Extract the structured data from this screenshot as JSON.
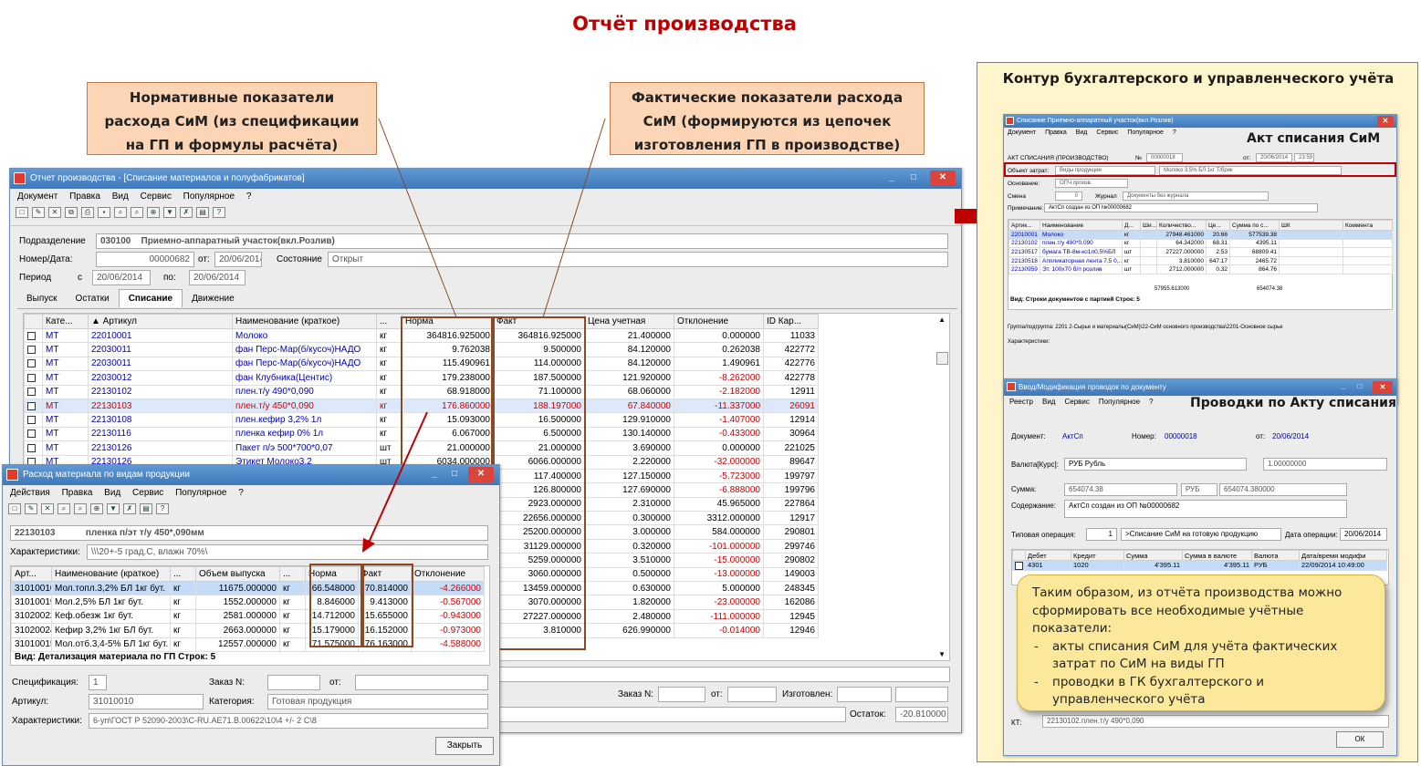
{
  "slide_title": "Отчёт производства",
  "callout_left": [
    "Нормативные показатели",
    "расхода СиМ (из спецификации",
    "на ГП и формулы расчёта)"
  ],
  "callout_right": [
    "Фактические показатели расхода",
    "СиМ (формируются из цепочек",
    "изготовления ГП в производстве)"
  ],
  "main_win": {
    "title": "Отчет производства - [Списание материалов и полуфабрикатов]",
    "menu": [
      "Документ",
      "Правка",
      "Вид",
      "Сервис",
      "Популярное",
      "?"
    ],
    "dept_label": "Подразделение",
    "dept_code": "030100",
    "dept_name": "Приемно-аппаратный участок(вкл.Розлив)",
    "num_label": "Номер/Дата:",
    "num_value": "00000682",
    "from_label": "от:",
    "date": "20/06/2014",
    "state_label": "Состояние",
    "state": "Открыт",
    "period_label": "Период",
    "period_from_label": "с",
    "period_from": "20/06/2014",
    "period_to_label": "по:",
    "period_to": "20/06/2014",
    "tabs": [
      "Выпуск",
      "Остатки",
      "Списание",
      "Движение"
    ],
    "columns": [
      "Кате...",
      "▲ Артикул",
      "Наименование (краткое)",
      "...",
      "Норма",
      "Факт",
      "Цена учетная",
      "Отклонение",
      "ID Кар..."
    ],
    "rows": [
      [
        "МТ",
        "22010001",
        "Молоко",
        "кг",
        "364816.925000",
        "364816.925000",
        "21.400000",
        "0.000000",
        "11033"
      ],
      [
        "МТ",
        "22030011",
        "фан Перс-Мар(б/кусоч)НАДО",
        "кг",
        "9.762038",
        "9.500000",
        "84.120000",
        "0.262038",
        "422772"
      ],
      [
        "МТ",
        "22030011",
        "фан Перс-Мар(б/кусоч)НАДО",
        "кг",
        "115.490961",
        "114.000000",
        "84.120000",
        "1.490961",
        "422776"
      ],
      [
        "МТ",
        "22030012",
        "фан Клубника(Центис)",
        "кг",
        "179.238000",
        "187.500000",
        "121.920000",
        "-8.262000",
        "422778"
      ],
      [
        "МТ",
        "22130102",
        "плен.т/у 490*0,090",
        "кг",
        "68.918000",
        "71.100000",
        "68.060000",
        "-2.182000",
        "12911"
      ],
      [
        "МТ",
        "22130103",
        "плен.т/у 450*0,090",
        "кг",
        "176.860000",
        "188.197000",
        "67.840000",
        "-11.337000",
        "26091"
      ],
      [
        "МТ",
        "22130108",
        "плен.кефир 3,2% 1л",
        "кг",
        "15.093000",
        "16.500000",
        "129.910000",
        "-1.407000",
        "12914"
      ],
      [
        "МТ",
        "22130116",
        "пленка кефир 0% 1л",
        "кг",
        "6.067000",
        "6.500000",
        "130.140000",
        "-0.433000",
        "30964"
      ],
      [
        "МТ",
        "22130126",
        "Пакет п/э 500*700*0,07",
        "шт",
        "21.000000",
        "21.000000",
        "3.690000",
        "0.000000",
        "221025"
      ],
      [
        "МТ",
        "22130126",
        "Этикет Молоко3,2",
        "шт",
        "6034.000000",
        "6066.000000",
        "2.220000",
        "-32.000000",
        "89647"
      ],
      [
        "",
        "",
        "",
        "",
        "",
        "117.400000",
        "127.150000",
        "-5.723000",
        "199797"
      ],
      [
        "",
        "",
        "",
        "",
        "",
        "126.800000",
        "127.690000",
        "-6.888000",
        "199796"
      ],
      [
        "",
        "",
        "",
        "",
        "",
        "2923.000000",
        "2.310000",
        "45.965000",
        "227864"
      ],
      [
        "",
        "",
        "",
        "",
        "",
        "22656.000000",
        "0.300000",
        "3312.000000",
        "12917"
      ],
      [
        "",
        "",
        "",
        "",
        "",
        "25200.000000",
        "3.000000",
        "584.000000",
        "290801"
      ],
      [
        "",
        "",
        "",
        "",
        "",
        "31129.000000",
        "0.320000",
        "-101.000000",
        "299746"
      ],
      [
        "",
        "",
        "",
        "",
        "",
        "5259.000000",
        "3.510000",
        "-15.000000",
        "290802"
      ],
      [
        "",
        "",
        "",
        "",
        "",
        "3060.000000",
        "0.500000",
        "-13.000000",
        "149003"
      ],
      [
        "",
        "",
        "",
        "",
        "",
        "13459.000000",
        "0.630000",
        "5.000000",
        "248345"
      ],
      [
        "",
        "",
        "",
        "",
        "",
        "3070.000000",
        "1.820000",
        "-23.000000",
        "162086"
      ],
      [
        "",
        "",
        "",
        "",
        "",
        "27227.000000",
        "2.480000",
        "-111.000000",
        "12945"
      ],
      [
        "",
        "",
        "",
        "",
        "",
        "3.810000",
        "626.990000",
        "-0.014000",
        "12946"
      ]
    ],
    "order_label": "Заказ N:",
    "from2_label": "от:",
    "made_label": "Изготовлен:",
    "rest_label": "Остаток:",
    "rest_value": "-20.810000"
  },
  "sub_win": {
    "title": "Расход материала по видам продукции",
    "menu": [
      "Действия",
      "Правка",
      "Вид",
      "Сервис",
      "Популярное",
      "?"
    ],
    "code": "22130103",
    "name": "пленка п/эт т/у 450*,090мм",
    "char_label": "Характеристики:",
    "char_value": "\\\\\\20+-5 град.С, влажн 70%\\",
    "columns": [
      "Арт...",
      "Наименование (краткое)",
      "...",
      "Объем выпуска",
      "...",
      "Норма",
      "Факт",
      "Отклонение"
    ],
    "rows": [
      [
        "31010010",
        "Мол.топл.3,2% БЛ 1кг бут.",
        "кг",
        "11675.000000",
        "кг",
        "66.548000",
        "70.814000",
        "-4.266000"
      ],
      [
        "31010019",
        "Мол.2,5% БЛ 1кг бут.",
        "кг",
        "1552.000000",
        "кг",
        "8.846000",
        "9.413000",
        "-0.567000"
      ],
      [
        "31020022",
        "Кеф.обезж 1кг бут.",
        "кг",
        "2581.000000",
        "кг",
        "14.712000",
        "15.655000",
        "-0.943000"
      ],
      [
        "31020024",
        "Кефир 3,2% 1кг БЛ бут.",
        "кг",
        "2663.000000",
        "кг",
        "15.179000",
        "16.152000",
        "-0.973000"
      ],
      [
        "31010015",
        "Мол.отб.3,4-5% БЛ 1кг бут.",
        "кг",
        "12557.000000",
        "кг",
        "71.575000",
        "76.163000",
        "-4.588000"
      ]
    ],
    "footer": "Вид: Детализация материала по ГП    Строк: 5",
    "spec_label": "Спецификация:",
    "spec_value": "1",
    "order_label": "Заказ N:",
    "from_label": "от:",
    "art_label": "Артикул:",
    "art_value": "31010010",
    "cat_label": "Категория:",
    "cat_value": "Готовая продукция",
    "char2_label": "Характеристики:",
    "char2_value": "6-уп\\ГОСТ Р 52090-2003\\С-RU.АЕ71.В.00622\\10\\4 +/- 2 С\\8",
    "close_button": "Закрыть"
  },
  "panel": {
    "title": "Контур бухгалтерского и управленческого учёта",
    "act_label": "Акт списания СиМ",
    "act_win": {
      "title": "Списание           Приемно-аппаратный участок(вкл.Розлив)",
      "menu": [
        "Документ",
        "Правка",
        "Вид",
        "Сервис",
        "Популярное",
        "?"
      ],
      "header": "АКТ СПИСАНИЯ (ПРОИЗВОДСТВО)",
      "num_label": "№",
      "num": "00000018",
      "from_label": "от:",
      "date": "20/06/2014",
      "time": "23:59",
      "obj_label": "Объект затрат:",
      "obj_value": "Виды продукции",
      "obj_value2": "Молоко 3,5% БЛ 1кг Т/брик",
      "basis_label": "Основание:",
      "basis_value": "ОПЧ.произв.",
      "smena_label": "Смена",
      "smena_value": "0",
      "journal_label": "Журнал",
      "journal_value": "Документы без журнала",
      "note_label": "Примечание:",
      "note_value": "АктСп создан из ОП №00000682",
      "columns": [
        "Артик...",
        "Наименование",
        "Д...",
        "Ши...",
        "Количество...",
        "Це...",
        "Сумма по с...",
        "ШК",
        "Коммента"
      ],
      "rows": [
        [
          "22010001",
          "Молоко",
          "кг",
          "27948.461000",
          "20.66",
          "577539.38"
        ],
        [
          "22130102",
          "плен.т/у 490*0,090",
          "кг",
          "64.342000",
          "68.31",
          "4395.11"
        ],
        [
          "22130517",
          "бумага ТВ-8м-ко1л0,5%БЛ",
          "шт",
          "27227.000000",
          "2.53",
          "68809.41"
        ],
        [
          "22130518",
          "Аппликаторная лента 7,5 0,...",
          "кг",
          "3.810000",
          "647.17",
          "2465.72"
        ],
        [
          "22130959",
          "Эт. 100х70 б/п розлив",
          "шт",
          "2712.000000",
          "0.32",
          "864.76"
        ]
      ],
      "total_qty": "57955.613000",
      "total_sum": "654074.38",
      "footer": "Вид: Строки документов с партией    Строк: 5",
      "group_label": "Группа/подгруппа:",
      "group_value": "2201 2-Сырье и материалы(СиМ)\\22-СиМ основного производства\\2201-Основное сырье",
      "char_label": "Характеристики:"
    },
    "post_label": "Проводки по Акту списания",
    "post_win": {
      "title": "Ввод/Модификация проводок по документу",
      "menu": [
        "Реестр",
        "Вид",
        "Сервис",
        "Популярное",
        "?"
      ],
      "doc_label": "Документ:",
      "doc_value": "АктСп",
      "num_label": "Номер:",
      "num_value": "00000018",
      "from_label": "от:",
      "date": "20/06/2014",
      "cur_label": "Валюта[Курс]:",
      "cur_value": "РУБ Рубль",
      "rate": "1.00000000",
      "sum_label": "Сумма:",
      "sum_value": "654074.38",
      "sum_cur": "РУБ",
      "sum_value2": "654074.380000",
      "content_label": "Содержание:",
      "content_value": "АктСп создан из ОП №00000682",
      "op_label": "Типовая операция:",
      "op_num": "1",
      "op_value": ">Списание СиМ на готовую продукцию",
      "opdate_label": "Дата операции:",
      "opdate": "20/06/2014",
      "columns": [
        "Дебет",
        "Кредит",
        "Сумма",
        "Сумма в валюте",
        "Валюта",
        "Дата/время модифи"
      ],
      "row": [
        "4301",
        "1020",
        "4'395.11",
        "4'395.11",
        "РУБ",
        "22/09/2014 10:49:00"
      ],
      "kt_label": "КТ:",
      "kt_value": "22130102.плен.т/у 490*0,090",
      "ok": "ОК"
    }
  },
  "note": {
    "intro": "Таким образом, из отчёта производства можно сформировать все необходимые учётные показатели:",
    "items": [
      "акты списания СиМ для учёта фактических затрат по СиМ на виды ГП",
      "проводки в ГК бухгалтерского и управленческого учёта"
    ]
  },
  "colors": {
    "accent_red": "#c00000",
    "title_blue": "#3e78bb"
  }
}
